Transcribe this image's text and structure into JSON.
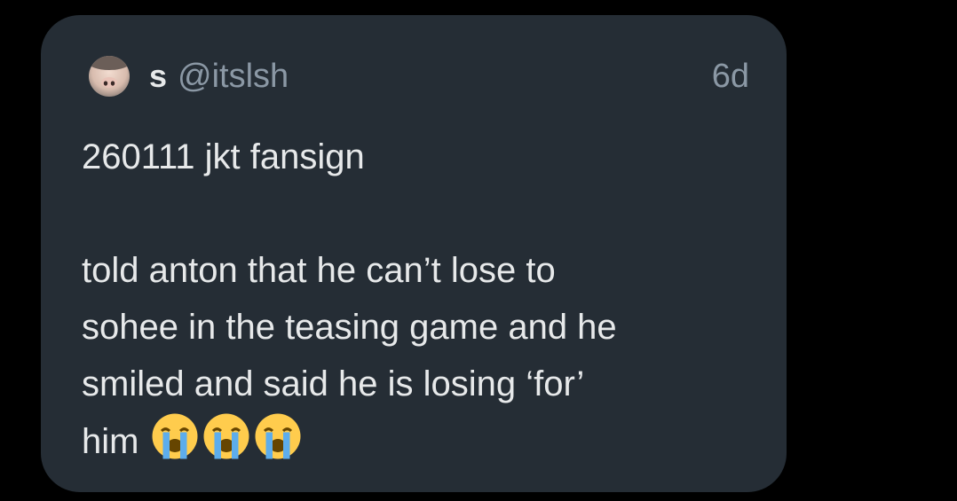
{
  "tweet": {
    "display_name": "s",
    "handle": "@itslsh",
    "time_ago": "6d",
    "text": "260111 jkt fansign\n\ntold anton that he can’t lose to\nsohee in the teasing game and he\nsmiled and said he is losing ‘for’\nhim",
    "emojis": [
      "loudly-crying-face-icon",
      "loudly-crying-face-icon",
      "loudly-crying-face-icon"
    ]
  },
  "colors": {
    "page_background": "#000000",
    "card_background": "#252d35",
    "primary_text": "#e7e9ea",
    "secondary_text": "#8b98a5"
  }
}
